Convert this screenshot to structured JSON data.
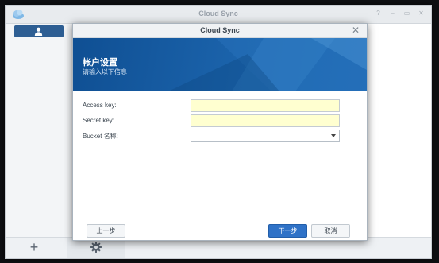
{
  "app": {
    "title": "Cloud Sync",
    "window_controls": [
      "?",
      "–",
      "▭",
      "✕"
    ]
  },
  "sidebar": {
    "account_icon": "user-icon"
  },
  "bottombar": {
    "add_label": "+",
    "settings_icon": "gear-icon"
  },
  "dialog": {
    "title": "Cloud Sync",
    "close_label": "✕",
    "banner_title": "帐户设置",
    "banner_subtitle": "请输入以下信息",
    "fields": {
      "access_key": {
        "label": "Access key:",
        "value": ""
      },
      "secret_key": {
        "label": "Secret key:",
        "value": ""
      },
      "bucket": {
        "label": "Bucket 名称:",
        "value": ""
      }
    },
    "buttons": {
      "prev": "上一步",
      "next": "下一步",
      "cancel": "取消"
    }
  },
  "colors": {
    "banner": "#1b63ab",
    "primary_button": "#2f72c7",
    "input_highlight": "#ffffd0"
  }
}
